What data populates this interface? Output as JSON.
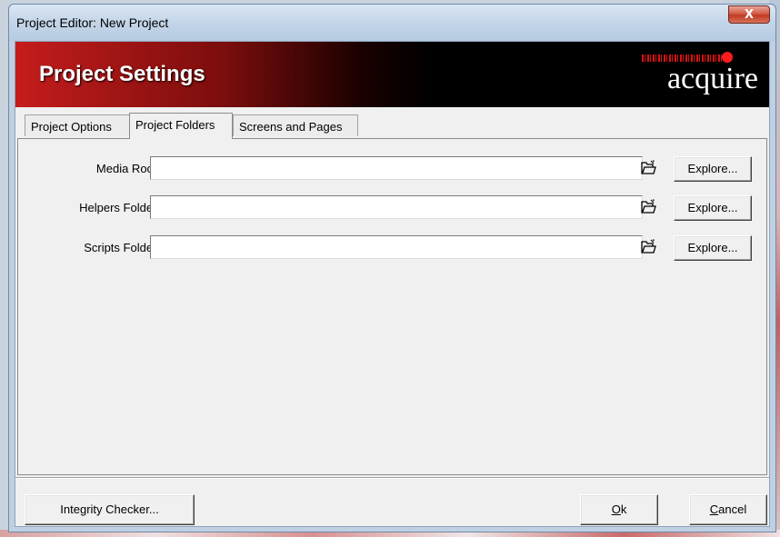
{
  "window": {
    "title": "Project Editor: New Project",
    "close_label": "X"
  },
  "banner": {
    "title": "Project Settings",
    "logo_text": "acquire"
  },
  "tabs": [
    {
      "label": "Project Options",
      "active": false
    },
    {
      "label": "Project Folders",
      "active": true
    },
    {
      "label": "Screens and Pages",
      "active": false
    }
  ],
  "fields": [
    {
      "label": "Media Root:",
      "value": "",
      "button": "Explore..."
    },
    {
      "label": "Helpers Folder:",
      "value": "",
      "button": "Explore..."
    },
    {
      "label": "Scripts Folder:",
      "value": "",
      "button": "Explore..."
    }
  ],
  "footer": {
    "integrity_label": "Integrity Checker...",
    "ok_mnemonic": "O",
    "ok_rest": "k",
    "cancel_mnemonic": "C",
    "cancel_rest": "ancel"
  },
  "colors": {
    "banner_red": "#c51c1c",
    "banner_black": "#000000",
    "logo_red": "#ff1c1c",
    "dialog_bg": "#f0f0f0"
  },
  "icons": {
    "folder": "open-folder-icon",
    "close": "close-icon"
  }
}
